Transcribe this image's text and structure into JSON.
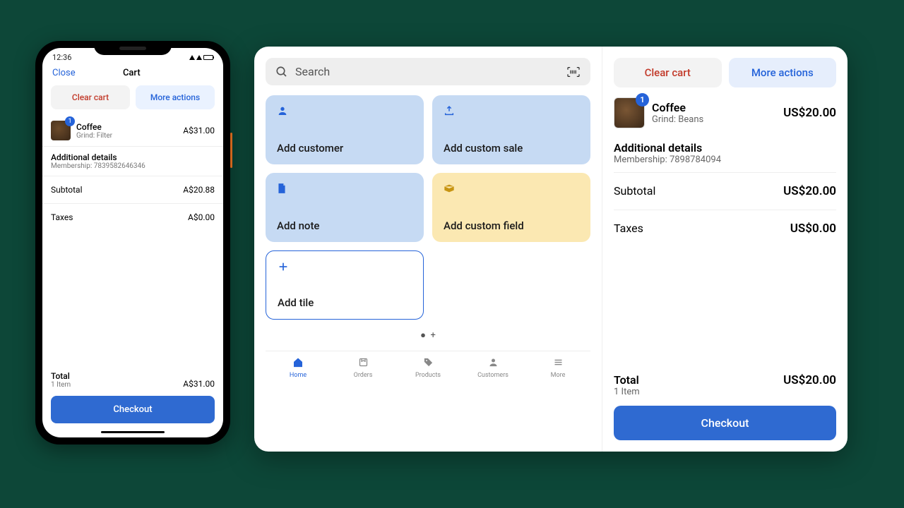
{
  "phone": {
    "status_time": "12:36",
    "nav": {
      "close": "Close",
      "title": "Cart"
    },
    "actions": {
      "clear": "Clear cart",
      "more": "More actions"
    },
    "item": {
      "badge": "1",
      "name": "Coffee",
      "variant": "Grind: Filter",
      "price": "A$31.00"
    },
    "details": {
      "title": "Additional details",
      "membership": "Membership: 7839582646346"
    },
    "subtotal": {
      "label": "Subtotal",
      "value": "A$20.88"
    },
    "taxes": {
      "label": "Taxes",
      "value": "A$0.00"
    },
    "total": {
      "label": "Total",
      "items": "1 Item",
      "value": "A$31.00"
    },
    "checkout": "Checkout"
  },
  "tablet": {
    "search_placeholder": "Search",
    "tiles": {
      "add_customer": "Add customer",
      "add_custom_sale": "Add custom sale",
      "add_note": "Add note",
      "add_custom_field": "Add custom field",
      "add_tile": "Add tile"
    },
    "bottom_nav": {
      "home": "Home",
      "orders": "Orders",
      "products": "Products",
      "customers": "Customers",
      "more": "More"
    },
    "cart": {
      "clear": "Clear cart",
      "more": "More actions",
      "item": {
        "badge": "1",
        "name": "Coffee",
        "variant": "Grind: Beans",
        "price": "US$20.00"
      },
      "details": {
        "title": "Additional details",
        "membership": "Membership: 7898784094"
      },
      "subtotal": {
        "label": "Subtotal",
        "value": "US$20.00"
      },
      "taxes": {
        "label": "Taxes",
        "value": "US$0.00"
      },
      "total": {
        "label": "Total",
        "items": "1 Item",
        "value": "US$20.00"
      },
      "checkout": "Checkout"
    }
  }
}
